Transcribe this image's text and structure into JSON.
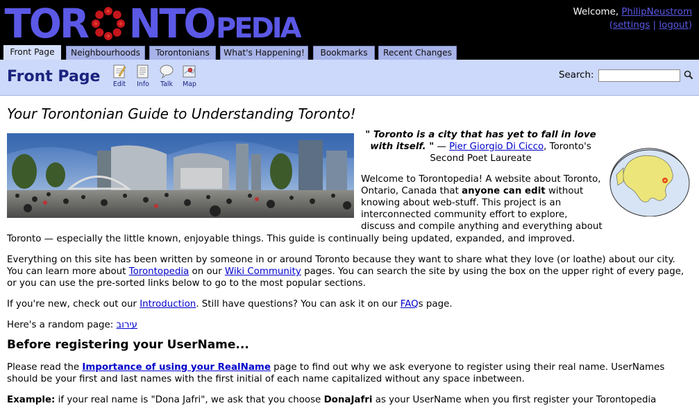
{
  "site": {
    "logo_part1": "TOR",
    "logo_part2": "NTO",
    "logo_part3": "PEDIA"
  },
  "user": {
    "welcome": "Welcome,",
    "name": "PhilipNeustrom",
    "settings": "settings",
    "separator": "|",
    "logout": "logout"
  },
  "tabs": [
    {
      "label": "Front Page",
      "active": true
    },
    {
      "label": "Neighbourhoods"
    },
    {
      "label": "Torontonians"
    },
    {
      "label": "What's Happening!"
    },
    {
      "label": "Bookmarks"
    },
    {
      "label": "Recent Changes"
    }
  ],
  "toolbar": {
    "title": "Front Page",
    "edit": "Edit",
    "info": "Info",
    "talk": "Talk",
    "map": "Map",
    "search_label": "Search:",
    "search_value": ""
  },
  "article": {
    "headline": "Your Torontonian Guide to Understanding Toronto!",
    "quote_text": "\" Toronto is a city that has yet to fall in love with itself. \"",
    "quote_dash": "—",
    "quote_author": "Pier Giorgio Di Cicco",
    "quote_role": ", Toronto's Second Poet Laureate",
    "intro_a": "Welcome to Torontopedia! A website about Toronto, Ontario, Canada that ",
    "intro_bold": "anyone can edit",
    "intro_b": " without knowing about web-stuff. This project is an interconnected community effort to explore, discuss and compile anything and everything about",
    "intro_c": "Toronto — especially the little known, enjoyable things. This guide is continually being updated, expanded, and improved.",
    "p2_a": "Everything on this site has been written by someone in or around Toronto because they want to share what they love (or loathe) about our city. You can learn more about ",
    "p2_link1": "Torontopedia",
    "p2_b": " on our ",
    "p2_link2": "Wiki Community",
    "p2_c": " pages. You can search the site by using the box on the upper right of every page, or you can use the pre-sorted links below to go to the most popular sections.",
    "p3_a": "If you're new, check out our ",
    "p3_link1": "Introduction",
    "p3_b": ". Still have questions? You can ask it on our ",
    "p3_link2": "FAQ",
    "p3_c": "s page.",
    "p4_a": "Here's a random page: ",
    "p4_link": "עירוב",
    "h2": "Before registering your UserName...",
    "p5_a": "Please read the ",
    "p5_link": "Importance of using your RealName",
    "p5_b": " page to find out why we ask everyone to register using their real name. UserNames should be your first and last names with the first initial of each name capitalized without any space inbetween.",
    "p6_label": "Example:",
    "p6_a": " if your real name is \"Dona Jafri\", we ask that you choose ",
    "p6_bold": "DonaJafri",
    "p6_b": " as your UserName when you first register your Torontopedia"
  },
  "colors": {
    "header_bg": "#000000",
    "logo": "#5b59e6",
    "tab": "#a8b3e8",
    "subheader": "#ccd9fb",
    "title": "#1a237e"
  }
}
